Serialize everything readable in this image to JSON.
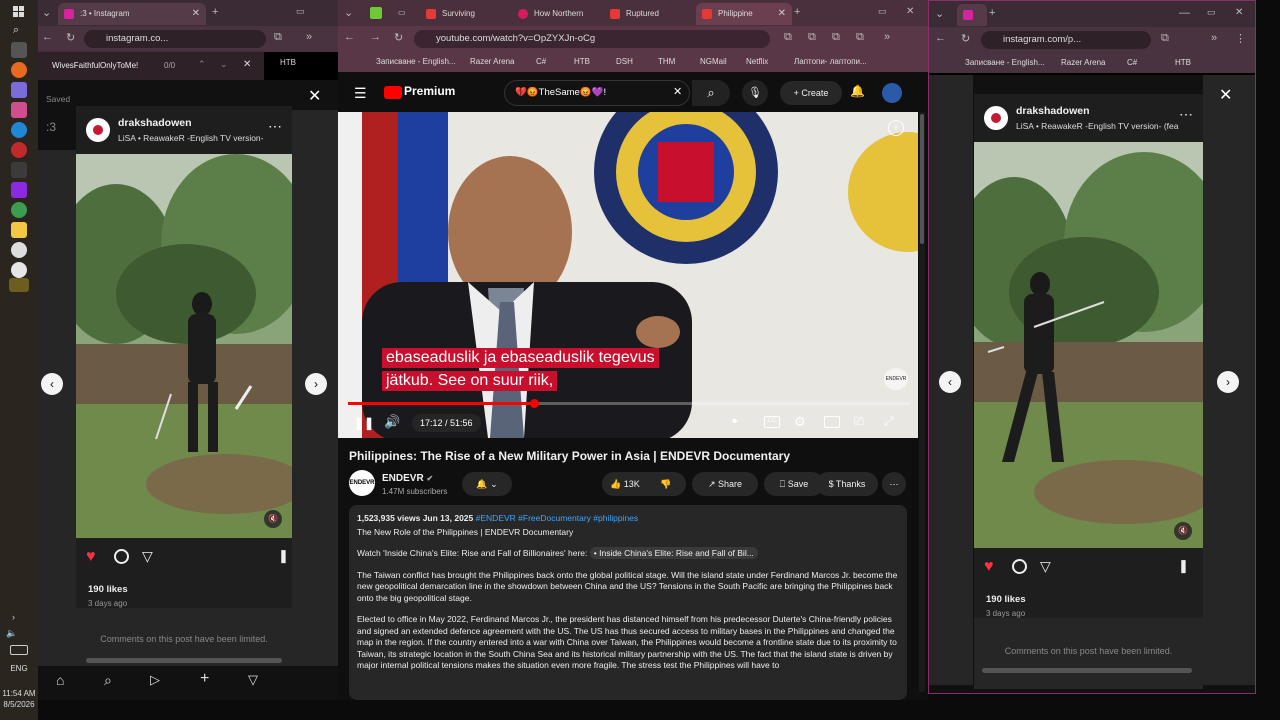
{
  "taskbar": {
    "clock": "11:54 AM",
    "date": "8/5/2026",
    "lang": "ENG"
  },
  "left_window": {
    "tab_title": ":3 • Instagram",
    "url": "instagram.co...",
    "find_query": "WivesFaithfulOnlyToMe!",
    "find_count": "0/0",
    "bookmark": "HTB",
    "saved_label": "Saved"
  },
  "middle_window": {
    "tabs": [
      "Surviving",
      "How Northern",
      "Ruptured",
      "Philippine"
    ],
    "url": "youtube.com/watch?v=OpZYXJn-oCg",
    "bookmarks": [
      "Записване - English...",
      "Razer Arena",
      "C#",
      "HTB",
      "DSH",
      "THM",
      "NGMail",
      "Netflix",
      "Лаптопи- лаптопи..."
    ]
  },
  "right_window": {
    "url": "instagram.com/p...",
    "bookmarks": [
      "Записване - English...",
      "Razer Arena",
      "C#",
      "HTB"
    ]
  },
  "ig_post": {
    "user": "drakshadowen",
    "song_left": "LiSA • ReawakeR -English TV version-",
    "song_right": "LiSA • ReawakeR -English TV version- (fea",
    "likes": "190 likes",
    "ago": "3 days ago",
    "comments_limited": "Comments on this post have been limited."
  },
  "youtube": {
    "logo": "Premium",
    "search_value": "💔😡TheSame😡💜!",
    "create_label": "Create",
    "caption_line1": "ebaseaduslik ja ebaseaduslik tegevus",
    "caption_line2": "jätkub. See on suur riik,",
    "time": "17:12 / 51:56",
    "watermark": "ENDEVR",
    "progress": 0.331,
    "title": "Philippines: The Rise of a New Military Power in Asia | ENDEVR Documentary",
    "channel": "ENDEVR",
    "subscribers": "1.47M subscribers",
    "likes": "13K",
    "share_label": "Share",
    "save_label": "Save",
    "thanks_label": "Thanks",
    "views_date": "1,523,935 views  Jun 13, 2025",
    "hashtags": "#ENDEVR #FreeDocumentary #philippines",
    "subtitle": "The New Role of the Philippines | ENDEVR Documentary",
    "watch_prefix": "Watch 'Inside China's Elite: Rise and Fall of Billionaires' here:",
    "watch_link": "• Inside China's Elite: Rise and Fall of Bil...",
    "para1": "The Taiwan conflict has brought the Philippines back onto the global political stage. Will the island state under Ferdinand Marcos Jr. become the new geopolitical demarcation line in the showdown between China and the US? Tensions in the South Pacific are bringing the Philippines back onto the big geopolitical stage.",
    "para2": "Elected to office in May 2022, Ferdinand Marcos Jr., the president has distanced himself from his predecessor Duterte's China-friendly policies and signed an extended defence agreement with the US. The US has thus secured access to military bases in the Philippines and changed the map in the region. If the country entered into a war with China over Taiwan, the Philippines would become a frontline state due to its proximity to Taiwan, its strategic location in the South China Sea and its historical military partnership with the US. The fact that the island state is driven by major internal political tensions makes the situation even more fragile. The stress test the Philippines will have to"
  }
}
